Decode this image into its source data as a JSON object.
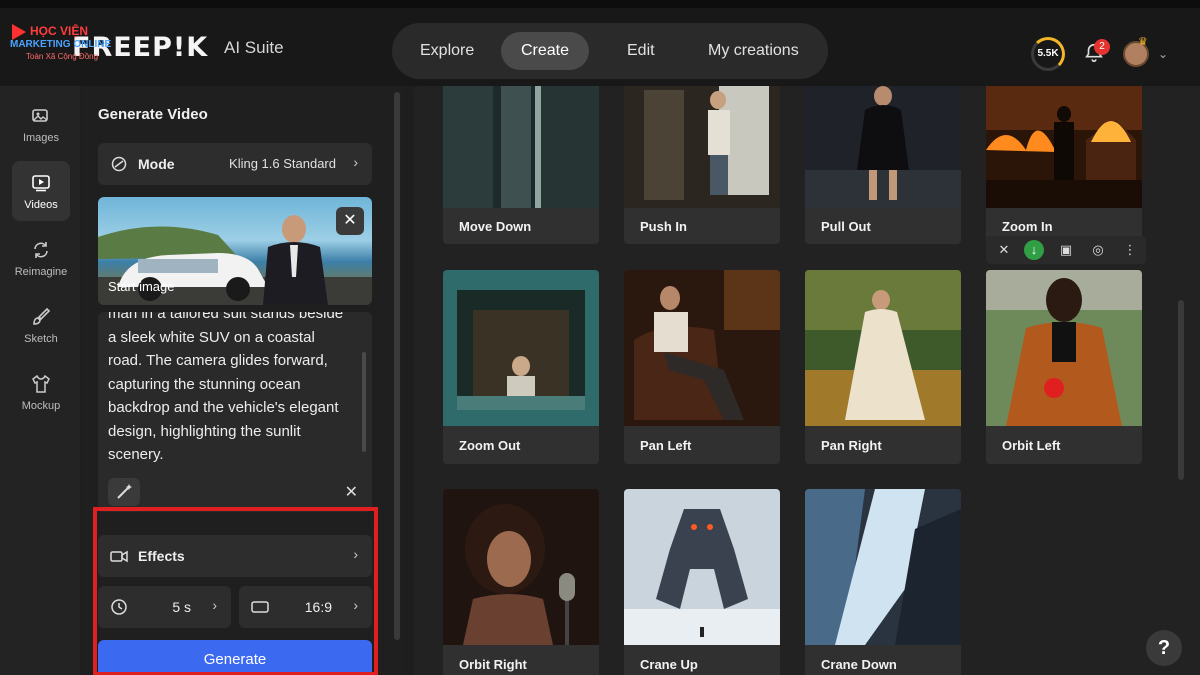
{
  "app": {
    "logo": "FREEP!K",
    "suite": "AI Suite",
    "watermark": {
      "line1": "HỌC VIỆN",
      "line2": "MARKETING ONLINE",
      "line3": "Toàn Xã Cộng Đồng"
    }
  },
  "nav": {
    "tabs": [
      {
        "label": "Explore"
      },
      {
        "label": "Create"
      },
      {
        "label": "Edit"
      },
      {
        "label": "My creations"
      }
    ],
    "active": "Create"
  },
  "header": {
    "credits": "5.5K",
    "notifications": "2"
  },
  "rail": {
    "items": [
      {
        "label": "Images",
        "icon": "image-icon"
      },
      {
        "label": "Videos",
        "icon": "video-icon"
      },
      {
        "label": "Reimagine",
        "icon": "refresh-icon"
      },
      {
        "label": "Sketch",
        "icon": "brush-icon"
      },
      {
        "label": "Mockup",
        "icon": "shirt-icon"
      }
    ],
    "active": "Videos"
  },
  "panel": {
    "title": "Generate Video",
    "mode_label": "Mode",
    "mode_value": "Kling 1.6 Standard",
    "start_image_label": "Start image",
    "prompt": "man in a tailored suit stands beside a sleek white SUV on a coastal road. The camera glides forward, capturing the stunning ocean backdrop and the vehicle's elegant design, highlighting the sunlit scenery.",
    "effects_label": "Effects",
    "duration": "5 s",
    "aspect_ratio": "16:9",
    "generate_label": "Generate"
  },
  "gallery": {
    "items": [
      {
        "label": "Move Down"
      },
      {
        "label": "Push In"
      },
      {
        "label": "Pull Out"
      },
      {
        "label": "Zoom In"
      },
      {
        "label": "Zoom Out"
      },
      {
        "label": "Pan Left"
      },
      {
        "label": "Pan Right"
      },
      {
        "label": "Orbit Left"
      },
      {
        "label": "Orbit Right"
      },
      {
        "label": "Crane Up"
      },
      {
        "label": "Crane Down"
      }
    ]
  },
  "help_label": "?"
}
